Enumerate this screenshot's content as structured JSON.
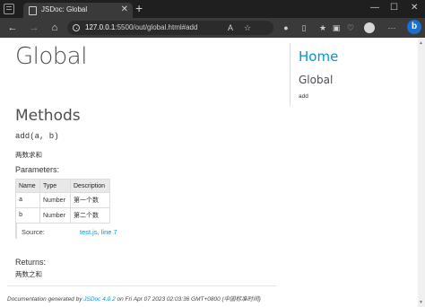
{
  "browser": {
    "tab_title": "JSDoc: Global",
    "tab_close": "✕",
    "new_tab": "+",
    "url_host": "127.0.0.1",
    "url_rest": ":5500/out/global.html#add",
    "window_controls": [
      "—",
      "☐",
      "✕"
    ]
  },
  "page": {
    "title": "Global",
    "section_heading": "Methods",
    "method_signature": "add(a, b)",
    "method_description": "两数求和",
    "parameters_heading": "Parameters:",
    "parameters_table": {
      "headers": [
        "Name",
        "Type",
        "Description"
      ],
      "rows": [
        [
          "a",
          "Number",
          "第一个数"
        ],
        [
          "b",
          "Number",
          "第二个数"
        ]
      ]
    },
    "source_label": "Source:",
    "source_link": "test.js, line 7",
    "returns_heading": "Returns:",
    "returns_description": "两数之和",
    "footer": {
      "prefix": "Documentation generated by ",
      "generator": "JSDoc 4.0.2",
      "suffix": " on Fri Apr 07 2023 02:03:36 GMT+0800 (中国标准时间)"
    }
  },
  "nav": {
    "home": "Home",
    "heading": "Global",
    "items": [
      "add"
    ]
  },
  "colors": {
    "link": "#0095dd",
    "browser_chrome": "#3a3a3a",
    "edge_accent": "#1a6fd1"
  }
}
